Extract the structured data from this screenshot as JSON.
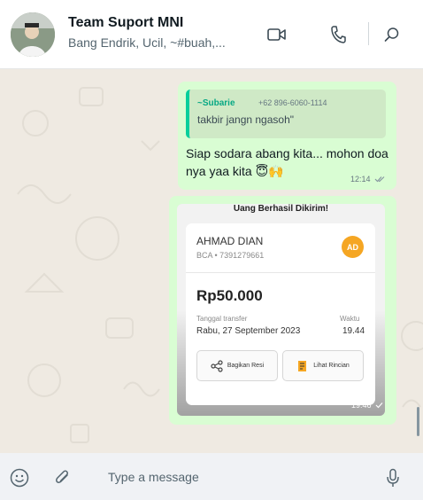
{
  "header": {
    "title": "Team Suport MNI",
    "subtitle": "Bang Endrik, Ucil, ~#buah,...",
    "icons": [
      "video-call-icon",
      "voice-call-icon",
      "search-icon"
    ]
  },
  "messages": [
    {
      "quoted": {
        "name": "~Subarie",
        "phone": "+62 896-6060-1114",
        "text": "takbir jangn ngasoh\""
      },
      "text": "Siap sodara abang kita... mohon doa nya yaa kita 😇🙌",
      "time": "12:14",
      "status_icon": "double-check-icon"
    },
    {
      "image": {
        "heading": "Uang Berhasil Dikirim!",
        "recipient_name": "AHMAD DIAN",
        "recipient_account": "BCA • 7391279661",
        "avatar_initials": "AD",
        "amount": "Rp50.000",
        "date_label": "Tanggal transfer",
        "date_value": "Rabu, 27 September 2023",
        "time_label": "Waktu",
        "time_value": "19.44",
        "share_button": "Bagikan Resi",
        "details_button": "Lihat Rincian"
      },
      "time": "19:46",
      "status_icon": "check-icon"
    }
  ],
  "composer": {
    "placeholder": "Type a message",
    "icons": [
      "emoji-icon",
      "attach-icon",
      "microphone-icon"
    ]
  },
  "colors": {
    "outgoing_bubble": "#d9fdd3",
    "chat_background": "#efeae2",
    "quote_accent": "#06cf9c",
    "avatar_badge": "#f5a623"
  }
}
